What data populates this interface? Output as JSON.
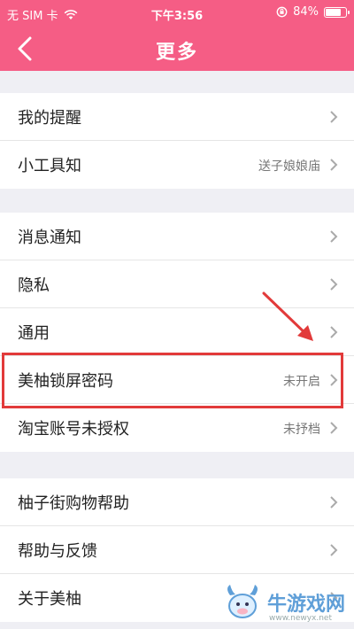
{
  "status_bar": {
    "carrier": "无 SIM 卡",
    "time": "下午3:56",
    "battery": "84%",
    "battery_level": 0.84
  },
  "nav": {
    "title": "更多"
  },
  "groups": [
    {
      "items": [
        {
          "label": "我的提醒",
          "value": ""
        },
        {
          "label": "小工具知",
          "value": "送子娘娘庙"
        }
      ]
    },
    {
      "items": [
        {
          "label": "消息通知",
          "value": ""
        },
        {
          "label": "隐私",
          "value": ""
        },
        {
          "label": "通用",
          "value": ""
        },
        {
          "label": "美柚锁屏密码",
          "value": "未开启"
        },
        {
          "label": "淘宝账号未授权",
          "value": "未抒档"
        }
      ]
    },
    {
      "items": [
        {
          "label": "柚子街购物帮助",
          "value": ""
        },
        {
          "label": "帮助与反馈",
          "value": ""
        },
        {
          "label": "关于美柚",
          "value": ""
        }
      ]
    }
  ],
  "watermark": {
    "brand": "牛游戏网",
    "url": "www.newyx.net"
  },
  "colors": {
    "accent": "#f55d85",
    "highlight": "#e23a3a"
  }
}
